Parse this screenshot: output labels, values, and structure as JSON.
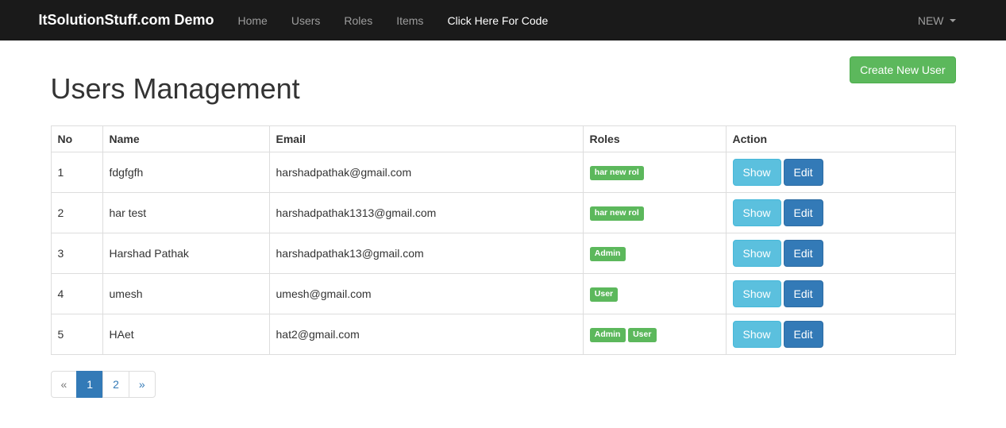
{
  "navbar": {
    "brand": "ItSolutionStuff.com Demo",
    "items": [
      {
        "label": "Home"
      },
      {
        "label": "Users"
      },
      {
        "label": "Roles"
      },
      {
        "label": "Items"
      },
      {
        "label": "Click Here For Code"
      }
    ],
    "right_label": "NEW"
  },
  "page": {
    "title": "Users Management",
    "create_button": "Create New User"
  },
  "table": {
    "headers": {
      "no": "No",
      "name": "Name",
      "email": "Email",
      "roles": "Roles",
      "action": "Action"
    },
    "rows": [
      {
        "no": "1",
        "name": "fdgfgfh",
        "email": "harshadpathak@gmail.com",
        "roles": [
          "har new rol"
        ]
      },
      {
        "no": "2",
        "name": "har test",
        "email": "harshadpathak1313@gmail.com",
        "roles": [
          "har new rol"
        ]
      },
      {
        "no": "3",
        "name": "Harshad Pathak",
        "email": "harshadpathak13@gmail.com",
        "roles": [
          "Admin"
        ]
      },
      {
        "no": "4",
        "name": "umesh",
        "email": "umesh@gmail.com",
        "roles": [
          "User"
        ]
      },
      {
        "no": "5",
        "name": "HAet",
        "email": "hat2@gmail.com",
        "roles": [
          "Admin",
          "User"
        ]
      }
    ],
    "actions": {
      "show": "Show",
      "edit": "Edit"
    }
  },
  "pagination": {
    "prev": "«",
    "pages": [
      "1",
      "2"
    ],
    "current": "1",
    "next": "»"
  }
}
